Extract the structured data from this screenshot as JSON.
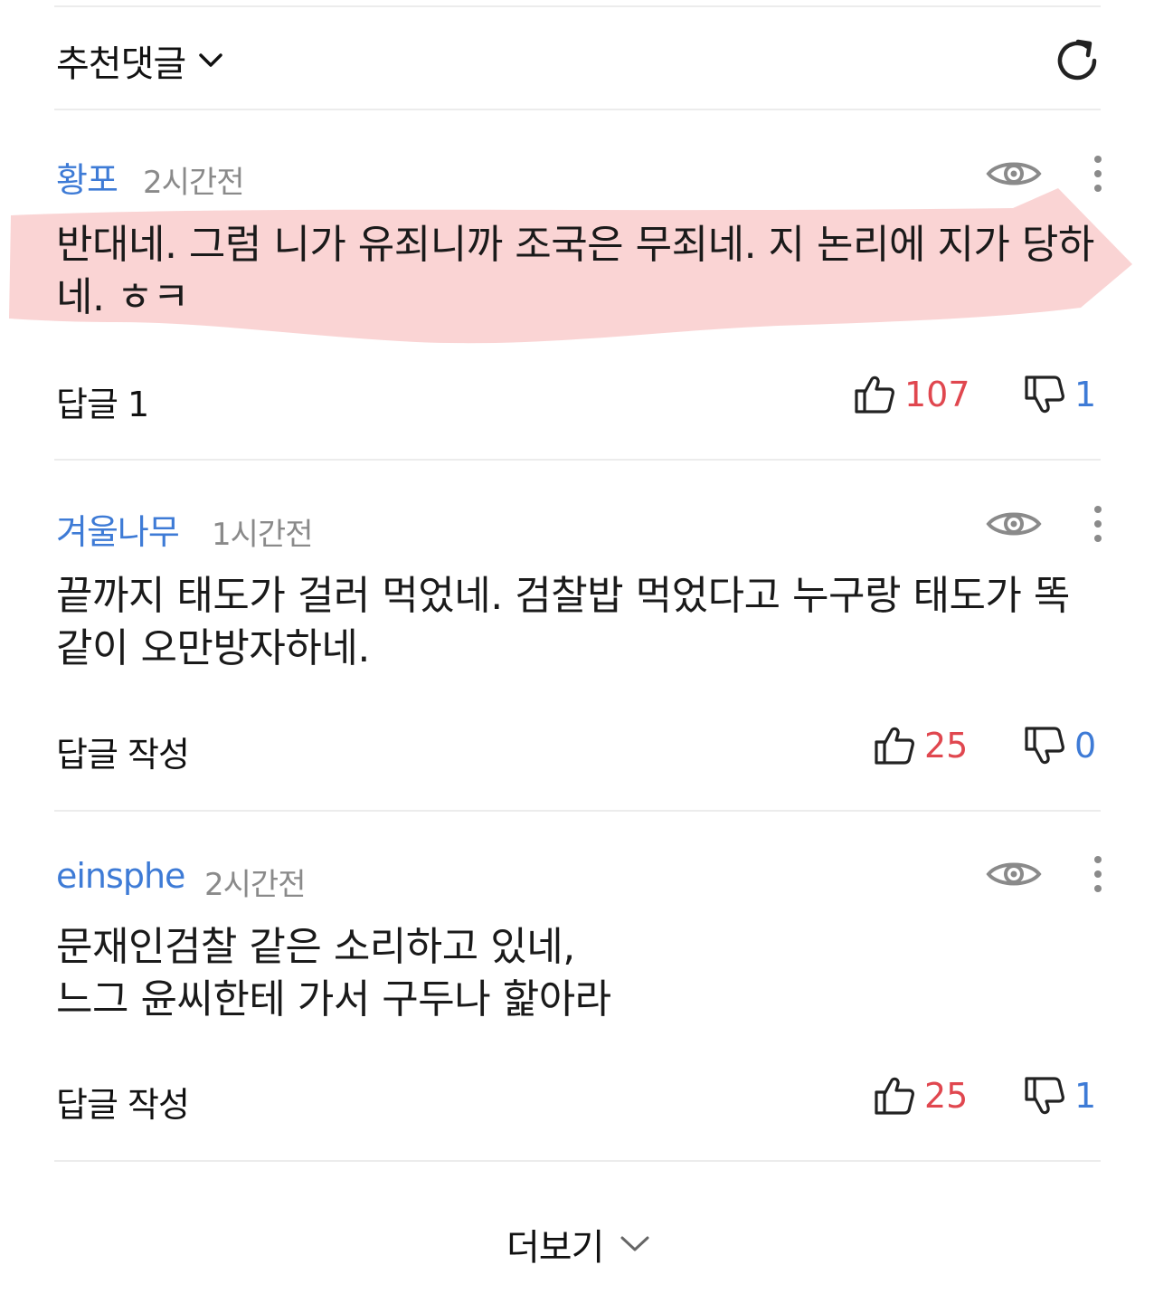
{
  "sort": {
    "label": "추천댓글"
  },
  "icons": {
    "sort_dropdown": "chevron-down-icon",
    "refresh": "refresh-icon",
    "view": "eye-icon",
    "more": "more-vertical-icon",
    "like": "thumbs-up-icon",
    "dislike": "thumbs-down-icon",
    "load_more": "chevron-down-icon"
  },
  "colors": {
    "author": "#3e7bd6",
    "like_count": "#e0474f",
    "dislike_count": "#3e7bd6",
    "highlight": "#f8c4c4"
  },
  "comments": [
    {
      "author": "황포",
      "time": "2시간전",
      "text": "반대네. 그럼 니가 유죄니까 조국은 무죄네. 지 논리에 지가 당하네. ㅎㅋ",
      "reply_label": "답글 1",
      "likes": "107",
      "dislikes": "1",
      "highlighted": true
    },
    {
      "author": "겨울나무",
      "time": "1시간전",
      "text": "끝까지 태도가 걸러 먹었네. 검찰밥 먹었다고 누구랑 태도가 똑같이 오만방자하네.",
      "reply_label": "답글 작성",
      "likes": "25",
      "dislikes": "0",
      "highlighted": false
    },
    {
      "author": "einsphe",
      "time": "2시간전",
      "text": "문재인검찰 같은 소리하고 있네,\n느그 윤씨한테 가서 구두나 핥아라",
      "reply_label": "답글 작성",
      "likes": "25",
      "dislikes": "1",
      "highlighted": false
    }
  ],
  "load_more": {
    "label": "더보기"
  }
}
